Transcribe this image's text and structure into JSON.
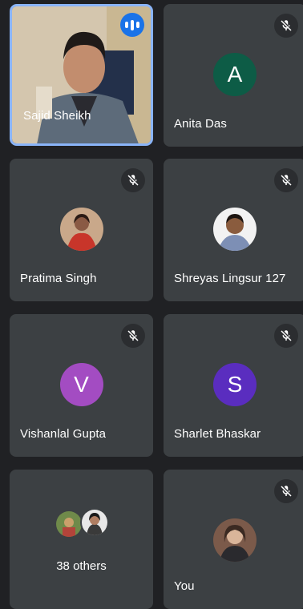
{
  "participants": [
    {
      "name": "Sajid Sheikh",
      "avatar_type": "video",
      "speaking": true,
      "muted": false
    },
    {
      "name": "Anita Das",
      "avatar_type": "initial",
      "initial": "A",
      "color": "#0d5c46",
      "muted": true
    },
    {
      "name": "Pratima Singh",
      "avatar_type": "photo",
      "muted": true
    },
    {
      "name": "Shreyas Lingsur 127",
      "avatar_type": "photo",
      "muted": true
    },
    {
      "name": "Vishanlal Gupta",
      "avatar_type": "initial",
      "initial": "V",
      "color": "#a34cc2",
      "muted": true
    },
    {
      "name": "Sharlet Bhaskar",
      "avatar_type": "initial",
      "initial": "S",
      "color": "#5a2dbf",
      "muted": true
    },
    {
      "name": "You",
      "avatar_type": "photo",
      "muted": true
    }
  ],
  "others": {
    "label": "38 others"
  },
  "colors": {
    "tile_bg": "#3c4043",
    "page_bg": "#202124",
    "active_border": "#8ab4f8",
    "speaking_badge": "#1a73e8"
  },
  "icons": {
    "muted": "mic-off-icon",
    "speaking": "audio-level-icon"
  }
}
